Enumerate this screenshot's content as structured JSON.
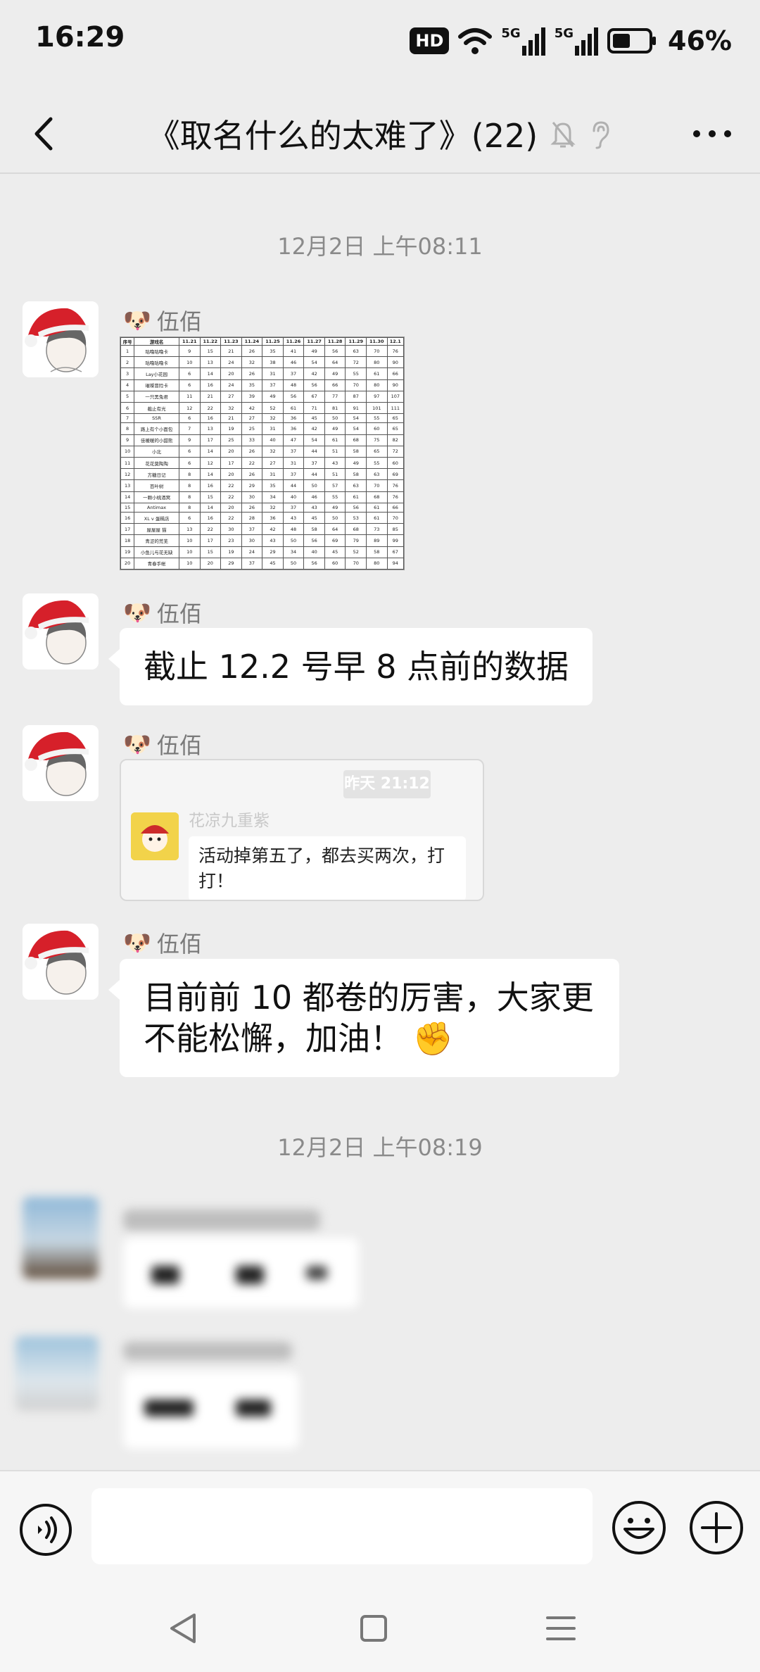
{
  "status_bar": {
    "time": "16:29",
    "hd_label": "HD",
    "network_5g_1": "5G",
    "network_5g_2": "5G",
    "battery_percent": "46%"
  },
  "header": {
    "title": "《取名什么的太难了》(22)",
    "icons": [
      "back-arrow-icon",
      "mute-bell-icon",
      "ear-icon",
      "more-dots-icon"
    ]
  },
  "messages": {
    "timestamp_1": "12月2日 上午08:11",
    "timestamp_2": "12月2日 上午08:19",
    "sender_name": "伍佰",
    "sender_badge": "🐶",
    "text_1": "截止 12.2 号早 8 点前的数据",
    "text_2": "目前前 10 都卷的厉害，大家更不能松懈，加油！",
    "text_2_emoji": "✊",
    "forward": {
      "time": "昨天 21:12",
      "sender": "花凉九重紫",
      "text": "活动掉第五了，都去买两次，打打！"
    }
  },
  "score_table": {
    "header": [
      "序号",
      "游戏名",
      "11.21",
      "11.22",
      "11.23",
      "11.24",
      "11.25",
      "11.26",
      "11.27",
      "11.28",
      "11.29",
      "11.30",
      "12.1"
    ],
    "rows": [
      [
        "1",
        "咕噜咕噜卡",
        "9",
        "15",
        "21",
        "26",
        "35",
        "41",
        "49",
        "56",
        "63",
        "70",
        "76"
      ],
      [
        "2",
        "咕噜咕噜卡",
        "10",
        "13",
        "24",
        "32",
        "38",
        "46",
        "54",
        "64",
        "72",
        "80",
        "90"
      ],
      [
        "3",
        "Lay小花园",
        "6",
        "14",
        "20",
        "26",
        "31",
        "37",
        "42",
        "49",
        "55",
        "61",
        "66"
      ],
      [
        "4",
        "璀璨冒险卡",
        "6",
        "16",
        "24",
        "35",
        "37",
        "48",
        "56",
        "66",
        "70",
        "80",
        "90"
      ],
      [
        "5",
        "一只黑兔君",
        "11",
        "21",
        "27",
        "39",
        "49",
        "56",
        "67",
        "77",
        "87",
        "97",
        "107"
      ],
      [
        "6",
        "截止有光",
        "12",
        "22",
        "32",
        "42",
        "52",
        "61",
        "71",
        "81",
        "91",
        "101",
        "111"
      ],
      [
        "7",
        "SSR",
        "6",
        "16",
        "21",
        "27",
        "32",
        "36",
        "45",
        "50",
        "54",
        "55",
        "65"
      ],
      [
        "8",
        "路上有个小面包",
        "7",
        "13",
        "19",
        "25",
        "31",
        "36",
        "42",
        "49",
        "54",
        "60",
        "65"
      ],
      [
        "9",
        "佳暖暖的小甜熊",
        "9",
        "17",
        "25",
        "33",
        "40",
        "47",
        "54",
        "61",
        "68",
        "75",
        "82"
      ],
      [
        "10",
        "小北",
        "6",
        "14",
        "20",
        "26",
        "32",
        "37",
        "44",
        "51",
        "58",
        "65",
        "72"
      ],
      [
        "11",
        "花花莫陶陶",
        "6",
        "12",
        "17",
        "22",
        "27",
        "31",
        "37",
        "43",
        "49",
        "55",
        "60"
      ],
      [
        "12",
        "方糖日记",
        "8",
        "14",
        "20",
        "26",
        "31",
        "37",
        "44",
        "51",
        "58",
        "63",
        "69"
      ],
      [
        "13",
        "百叶树",
        "8",
        "16",
        "22",
        "29",
        "35",
        "44",
        "50",
        "57",
        "63",
        "70",
        "76"
      ],
      [
        "14",
        "一颗小桃酒窝",
        "8",
        "15",
        "22",
        "30",
        "34",
        "40",
        "46",
        "55",
        "61",
        "68",
        "76"
      ],
      [
        "15",
        "Antimax",
        "8",
        "14",
        "20",
        "26",
        "32",
        "37",
        "43",
        "49",
        "56",
        "61",
        "66"
      ],
      [
        "16",
        "XL v 蛋糕店",
        "6",
        "16",
        "22",
        "28",
        "36",
        "43",
        "45",
        "50",
        "53",
        "61",
        "70"
      ],
      [
        "17",
        "屋屋屋 猫",
        "13",
        "22",
        "30",
        "37",
        "42",
        "48",
        "58",
        "64",
        "68",
        "73",
        "85"
      ],
      [
        "18",
        "青涩的荒芜",
        "10",
        "17",
        "23",
        "30",
        "43",
        "50",
        "56",
        "69",
        "79",
        "89",
        "99"
      ],
      [
        "19",
        "小鱼儿与花无缺",
        "10",
        "15",
        "19",
        "24",
        "29",
        "34",
        "40",
        "45",
        "52",
        "58",
        "67"
      ],
      [
        "20",
        "青春手帐",
        "10",
        "20",
        "29",
        "37",
        "45",
        "50",
        "56",
        "60",
        "70",
        "80",
        "94"
      ]
    ]
  },
  "input": {
    "placeholder": ""
  },
  "colors": {
    "background": "#ededed",
    "bubble": "#ffffff",
    "timestamp": "#8a8a8a"
  }
}
